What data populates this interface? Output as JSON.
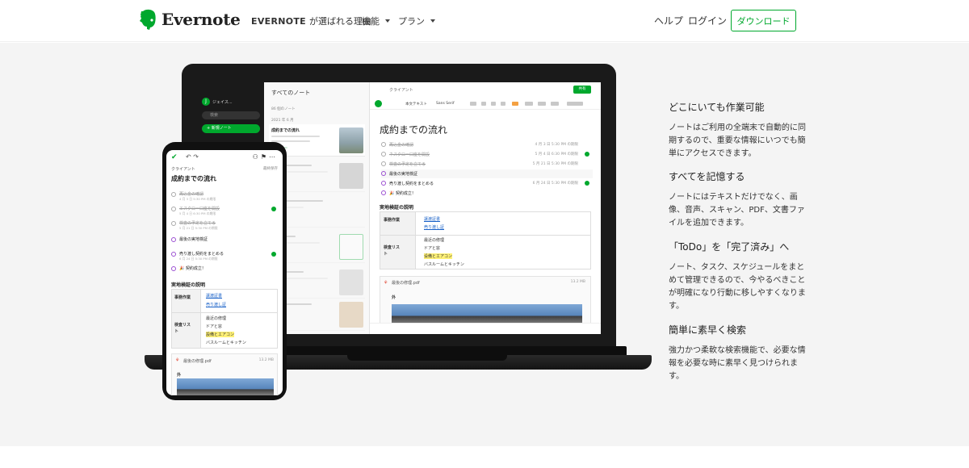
{
  "nav": {
    "brand": "Evernote",
    "why_brand": "EVERNOTE",
    "why_suffix": "が選ばれる理由",
    "features": "機能",
    "plans": "プラン",
    "help": "ヘルプ",
    "login": "ログイン",
    "download": "ダウンロード",
    "brand_color": "#00a82d"
  },
  "laptop_app": {
    "user": "ジェイス...",
    "search_placeholder": "検索",
    "new_note": "+ 新規ノート",
    "list_title": "すべてのノート",
    "list_count": "86 個のノート",
    "list_date": "2021 年 6 月",
    "selected_note": "成約までの流れ",
    "crumb": "クライアント",
    "share": "共有",
    "format": "本文テキスト",
    "font": "Sans Serif",
    "note_title": "成約までの流れ",
    "tasks": [
      {
        "text": "再込金の確認",
        "date": "4 月 3 日 5:30 PM の期限",
        "done": true
      },
      {
        "text": "ネスクロー口座を開設",
        "date": "5 月 4 日 6:30 PM の期限",
        "done": true
      },
      {
        "text": "検査の予定を立てる",
        "date": "5 月 21 日 5:30 PM の期限",
        "done": true
      },
      {
        "text": "最後の実地検証",
        "date": "",
        "done": false
      },
      {
        "text": "売り渡し契約をまとめる",
        "date": "6 月 24 日 5:30 PM の期限",
        "done": false
      },
      {
        "text": "🎉 契約成立！",
        "date": "",
        "done": false
      }
    ],
    "section_title": "実地検証の説明",
    "table": {
      "row1_head": "事務作業",
      "row1_items": [
        "譲渡証書",
        "売り渡し証"
      ],
      "row2_head": "検査リスト",
      "row2_items": [
        "最近の修理",
        "ドアと窓",
        "设備とエアコン",
        "バスルームとキッチン"
      ]
    },
    "pdf_name": "最後の修理.pdf",
    "pdf_size": "13.2 MB",
    "pdf_heading": "外"
  },
  "phone_app": {
    "crumb": "クライアント",
    "crumb_right": "最終保存",
    "title": "成約までの流れ",
    "tasks": [
      {
        "text": "再込金の確認",
        "sub": "4 月 3 日 5:30 PM の期限",
        "done": true
      },
      {
        "text": "エスクロー口座を開設",
        "sub": "5 月 4 日 6:30 PM の期限",
        "done": true
      },
      {
        "text": "検査の予定を立てる",
        "sub": "5 月 21 日 5:30 PM の期限",
        "done": true
      },
      {
        "text": "最後の実地検証",
        "sub": "",
        "done": false
      },
      {
        "text": "売り渡し契約をまとめる",
        "sub": "6 月 24 日 5:30 PM の期限",
        "done": false
      },
      {
        "text": "🎉 契約成立！",
        "sub": "",
        "done": false
      }
    ],
    "section_title": "実地検証の説明",
    "row1_head": "事務作業",
    "row1_items": [
      "譲渡証書",
      "売り渡し証"
    ],
    "row2_head": "検査リスト",
    "row2_items": [
      "最近の修理",
      "ドアと窓",
      "設備とエアコン",
      "バスルームとキッチン"
    ],
    "pdf_name": "最後の修理.pdf",
    "pdf_size": "13.2 MB",
    "pdf_heading": "外"
  },
  "features": [
    {
      "title": "どこにいても作業可能",
      "body": "ノートはご利用の全端末で自動的に同期するので、重要な情報にいつでも簡単にアクセスできます。"
    },
    {
      "title": "すべてを記憶する",
      "body": "ノートにはテキストだけでなく、画像、音声、スキャン、PDF、文書ファイルを追加できます。"
    },
    {
      "title": "「ToDo」を「完了済み」へ",
      "body": "ノート、タスク、スケジュールをまとめて管理できるので、今やるべきことが明確になり行動に移しやすくなります。"
    },
    {
      "title": "簡単に素早く検索",
      "body": "強力かつ柔軟な検索機能で、必要な情報を必要な時に素早く見つけられます。"
    }
  ]
}
